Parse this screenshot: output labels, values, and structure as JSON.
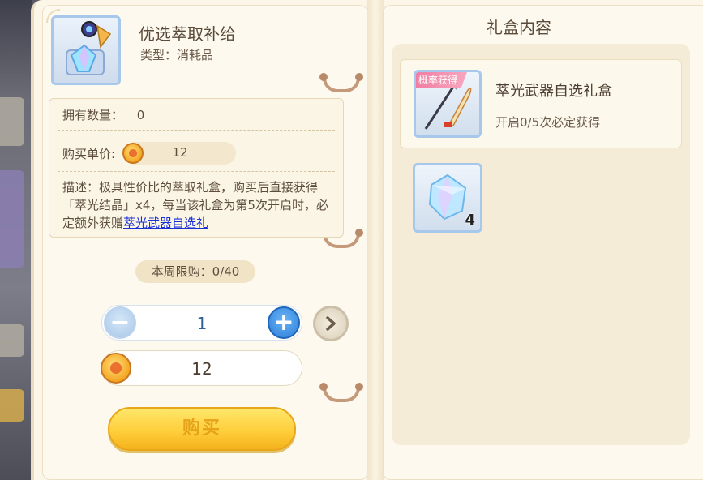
{
  "item": {
    "title": "优选萃取补给",
    "type": "类型：消耗品",
    "icon": "gem-box-icon"
  },
  "info": {
    "owned_label": "拥有数量：",
    "owned_value": "0",
    "price_label": "购买单价:",
    "price_value": "12",
    "description": "描述：极具性价比的萃取礼盒，购买后直接获得「萃光结晶」x4，每当该礼盒为第5次开启时，必定额外获赠",
    "description_link": "萃光武器自选礼"
  },
  "purchase": {
    "weekly_limit": "本周限购：0/40",
    "quantity": "1",
    "total": "12",
    "buy_label": "购买",
    "minus_symbol": "−",
    "plus_symbol": "+"
  },
  "contents": {
    "title": "礼盒内容",
    "rewards": [
      {
        "badge": "概率获得",
        "name": "萃光武器自选礼盒",
        "sub": "开启0/5次必定获得",
        "icon": "weapon-selection-icon"
      },
      {
        "count": "4",
        "icon": "crystal-icon"
      }
    ]
  },
  "colors": {
    "accent_blue": "#2c7ed8",
    "buy_yellow": "#ffcf3c",
    "link_blue": "#1a2fd6",
    "page_bg": "#fdf9ee"
  }
}
